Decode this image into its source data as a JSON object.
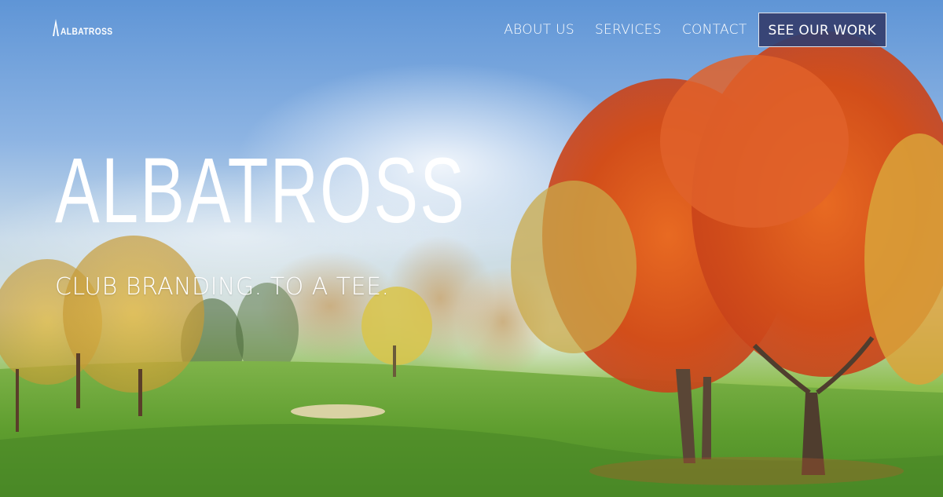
{
  "brand": {
    "logo_text": "ALBATROSS"
  },
  "nav": {
    "items": [
      {
        "label": "ABOUT US"
      },
      {
        "label": "SERVICES"
      },
      {
        "label": "CONTACT"
      }
    ],
    "cta_label": "SEE OUR WORK"
  },
  "hero": {
    "title": "ALBATROSS",
    "tagline": "CLUB BRANDING. TO A TEE."
  },
  "colors": {
    "cta_background": "#343e6e",
    "text": "#ffffff",
    "sky": "#5f95d6",
    "grass": "#6aa43a",
    "foliage_orange": "#d9531c"
  }
}
